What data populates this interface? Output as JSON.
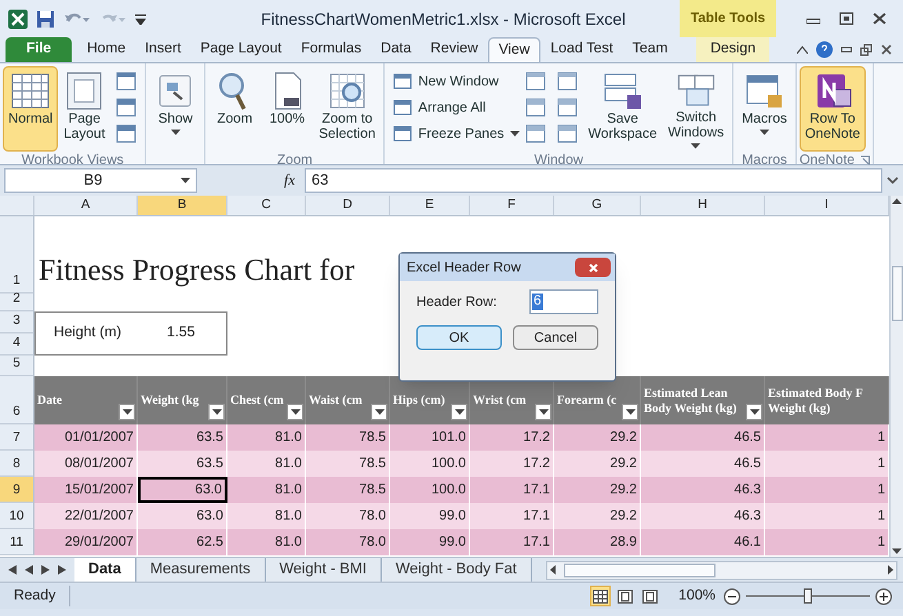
{
  "title_bar": {
    "title": "FitnessChartWomenMetric1.xlsx - Microsoft Excel",
    "context_label": "Table Tools"
  },
  "ribbon_tabs": [
    {
      "label": "File",
      "kind": "file",
      "selected": false
    },
    {
      "label": "Home",
      "kind": "normal",
      "selected": false
    },
    {
      "label": "Insert",
      "kind": "normal",
      "selected": false
    },
    {
      "label": "Page Layout",
      "kind": "normal",
      "selected": false
    },
    {
      "label": "Formulas",
      "kind": "normal",
      "selected": false
    },
    {
      "label": "Data",
      "kind": "normal",
      "selected": false
    },
    {
      "label": "Review",
      "kind": "normal",
      "selected": false
    },
    {
      "label": "View",
      "kind": "normal",
      "selected": true
    },
    {
      "label": "Load Test",
      "kind": "normal",
      "selected": false
    },
    {
      "label": "Team",
      "kind": "normal",
      "selected": false
    },
    {
      "label": "Design",
      "kind": "context",
      "selected": false
    }
  ],
  "ribbon_groups": [
    {
      "label": "Workbook Views",
      "items": [
        {
          "kind": "large",
          "label": "Normal",
          "selected": true
        },
        {
          "kind": "large",
          "label": "Page\nLayout",
          "selected": false
        },
        {
          "kind": "icons"
        }
      ]
    },
    {
      "items": [
        {
          "kind": "large",
          "label": "Show",
          "selected": false,
          "dropdown": true
        }
      ]
    },
    {
      "label": "Zoom",
      "items": [
        {
          "kind": "large",
          "label": "Zoom",
          "selected": false
        },
        {
          "kind": "large",
          "label": "100%",
          "selected": false
        },
        {
          "kind": "large",
          "label": "Zoom to\nSelection",
          "selected": false
        }
      ]
    },
    {
      "label": "Window",
      "items": [
        {
          "kind": "small",
          "entries": [
            {
              "label": "New Window"
            },
            {
              "label": "Arrange All"
            },
            {
              "label": "Freeze Panes",
              "dropdown": true
            }
          ]
        },
        {
          "kind": "icons"
        },
        {
          "kind": "icons"
        },
        {
          "kind": "large",
          "label": "Save\nWorkspace",
          "selected": false
        },
        {
          "kind": "large",
          "label": "Switch\nWindows",
          "selected": false,
          "dropdown": true
        }
      ]
    },
    {
      "label": "Macros",
      "items": [
        {
          "kind": "large",
          "label": "Macros",
          "selected": false,
          "dropdown": true
        }
      ]
    },
    {
      "label": "OneNote",
      "launcher": true,
      "items": [
        {
          "kind": "large",
          "label": "Row To\nOneNote",
          "selected": true
        }
      ]
    }
  ],
  "formula_bar": {
    "name_box": "B9",
    "fx": "fx",
    "value": "63"
  },
  "columns": [
    {
      "label": "A",
      "selected": false
    },
    {
      "label": "B",
      "selected": true
    },
    {
      "label": "C",
      "selected": false
    },
    {
      "label": "D",
      "selected": false
    },
    {
      "label": "E",
      "selected": false
    },
    {
      "label": "F",
      "selected": false
    },
    {
      "label": "G",
      "selected": false
    },
    {
      "label": "H",
      "selected": false
    },
    {
      "label": "I",
      "selected": false
    }
  ],
  "row_numbers": [
    {
      "label": "1",
      "selected": false
    },
    {
      "label": "2",
      "selected": false
    },
    {
      "label": "3",
      "selected": false
    },
    {
      "label": "4",
      "selected": false
    },
    {
      "label": "5",
      "selected": false
    },
    {
      "label": "6",
      "selected": false
    },
    {
      "label": "7",
      "selected": false
    },
    {
      "label": "8",
      "selected": false
    },
    {
      "label": "9",
      "selected": true
    },
    {
      "label": "10",
      "selected": false
    },
    {
      "label": "11",
      "selected": false
    }
  ],
  "sheet_title": "Fitness Progress Chart for",
  "height_box": {
    "label": "Height (m)",
    "value": "1.55"
  },
  "table": {
    "columns": [
      {
        "label": "Date",
        "filter": true
      },
      {
        "label": "Weight (kg",
        "filter": true
      },
      {
        "label": "Chest (cm",
        "filter": true
      },
      {
        "label": "Waist (cm",
        "filter": true
      },
      {
        "label": "Hips (cm)",
        "filter": true
      },
      {
        "label": "Wrist (cm",
        "filter": true
      },
      {
        "label": "Forearm (c",
        "filter": true
      },
      {
        "label": "Estimated Lean Body Weight (kg)",
        "filter": true
      },
      {
        "label": "Estimated Body F Weight (kg)",
        "filter": false
      }
    ],
    "rows": [
      {
        "cells": [
          {
            "text": "01/01/2007",
            "active": false
          },
          {
            "text": "63.5",
            "active": false
          },
          {
            "text": "81.0",
            "active": false
          },
          {
            "text": "78.5",
            "active": false
          },
          {
            "text": "101.0",
            "active": false
          },
          {
            "text": "17.2",
            "active": false
          },
          {
            "text": "29.2",
            "active": false
          },
          {
            "text": "46.5",
            "active": false
          },
          {
            "text": "1",
            "active": false
          }
        ]
      },
      {
        "cells": [
          {
            "text": "08/01/2007",
            "active": false
          },
          {
            "text": "63.5",
            "active": false
          },
          {
            "text": "81.0",
            "active": false
          },
          {
            "text": "78.5",
            "active": false
          },
          {
            "text": "100.0",
            "active": false
          },
          {
            "text": "17.2",
            "active": false
          },
          {
            "text": "29.2",
            "active": false
          },
          {
            "text": "46.5",
            "active": false
          },
          {
            "text": "1",
            "active": false
          }
        ]
      },
      {
        "cells": [
          {
            "text": "15/01/2007",
            "active": false
          },
          {
            "text": "63.0",
            "active": true
          },
          {
            "text": "81.0",
            "active": false
          },
          {
            "text": "78.5",
            "active": false
          },
          {
            "text": "100.0",
            "active": false
          },
          {
            "text": "17.1",
            "active": false
          },
          {
            "text": "29.2",
            "active": false
          },
          {
            "text": "46.3",
            "active": false
          },
          {
            "text": "1",
            "active": false
          }
        ]
      },
      {
        "cells": [
          {
            "text": "22/01/2007",
            "active": false
          },
          {
            "text": "63.0",
            "active": false
          },
          {
            "text": "81.0",
            "active": false
          },
          {
            "text": "78.0",
            "active": false
          },
          {
            "text": "99.0",
            "active": false
          },
          {
            "text": "17.1",
            "active": false
          },
          {
            "text": "29.2",
            "active": false
          },
          {
            "text": "46.3",
            "active": false
          },
          {
            "text": "1",
            "active": false
          }
        ]
      },
      {
        "cells": [
          {
            "text": "29/01/2007",
            "active": false
          },
          {
            "text": "62.5",
            "active": false
          },
          {
            "text": "81.0",
            "active": false
          },
          {
            "text": "78.0",
            "active": false
          },
          {
            "text": "99.0",
            "active": false
          },
          {
            "text": "17.1",
            "active": false
          },
          {
            "text": "28.9",
            "active": false
          },
          {
            "text": "46.1",
            "active": false
          },
          {
            "text": "1",
            "active": false
          }
        ]
      }
    ]
  },
  "dialog": {
    "title": "Excel Header Row",
    "field_label": "Header Row:",
    "field_value": "6",
    "buttons": [
      {
        "label": "OK",
        "default": true
      },
      {
        "label": "Cancel",
        "default": false
      }
    ]
  },
  "sheet_tabs": [
    {
      "label": "Data",
      "selected": true
    },
    {
      "label": "Measurements",
      "selected": false
    },
    {
      "label": "Weight - BMI",
      "selected": false
    },
    {
      "label": "Weight - Body Fat",
      "selected": false
    }
  ],
  "status_bar": {
    "status": "Ready",
    "views": [
      {
        "selected": true
      },
      {
        "selected": false
      },
      {
        "selected": false
      }
    ],
    "zoom": "100%",
    "zoom_slider": {
      "level": 0.5
    }
  }
}
